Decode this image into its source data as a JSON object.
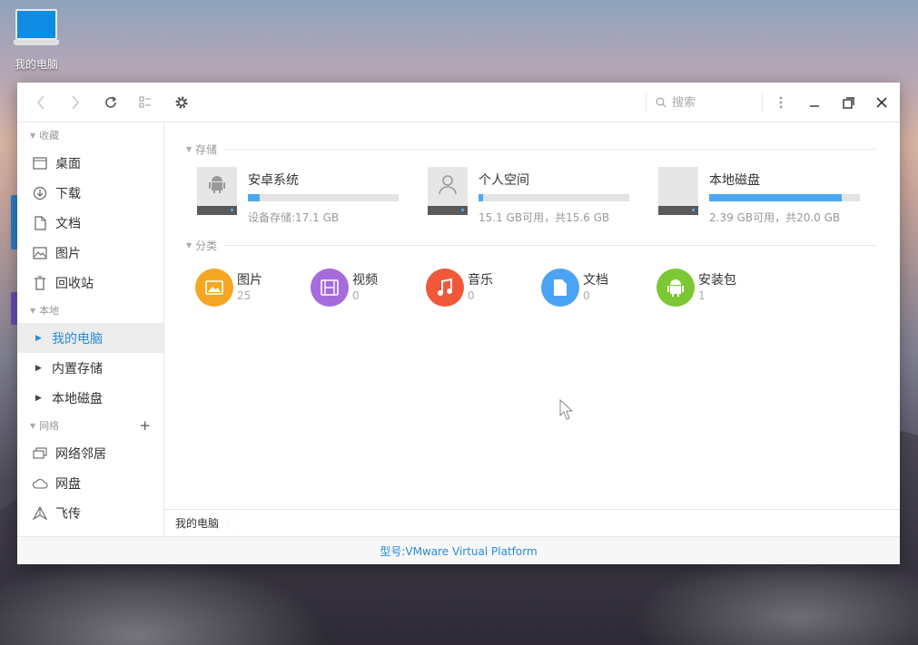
{
  "desktop": {
    "icon_label": "我的电脑"
  },
  "toolbar": {
    "search_placeholder": "搜索",
    "icons": [
      "back-icon",
      "forward-icon",
      "refresh-icon",
      "view-mode-icon",
      "settings-icon",
      "more-icon",
      "minimize-icon",
      "maximize-icon",
      "close-icon"
    ]
  },
  "sidebar": {
    "sections": [
      {
        "title": "收藏",
        "items": [
          {
            "label": "桌面",
            "icon": "desktop-icon"
          },
          {
            "label": "下载",
            "icon": "download-icon"
          },
          {
            "label": "文档",
            "icon": "document-icon"
          },
          {
            "label": "图片",
            "icon": "image-icon"
          },
          {
            "label": "回收站",
            "icon": "trash-icon"
          }
        ]
      },
      {
        "title": "本地",
        "items": [
          {
            "label": "我的电脑",
            "active": true
          },
          {
            "label": "内置存储"
          },
          {
            "label": "本地磁盘"
          }
        ]
      },
      {
        "title": "网络",
        "items": [
          {
            "label": "网络邻居",
            "icon": "network-neighbor-icon"
          },
          {
            "label": "网盘",
            "icon": "cloud-icon"
          },
          {
            "label": "飞传",
            "icon": "fly-transfer-icon"
          }
        ]
      }
    ]
  },
  "main": {
    "storage_title": "存储",
    "storage": [
      {
        "name": "安卓系统",
        "info": "设备存储:17.1 GB",
        "usage": 0.08,
        "icon": "android-icon"
      },
      {
        "name": "个人空间",
        "info": "15.1 GB可用，共15.6 GB",
        "usage": 0.03,
        "icon": "person-icon"
      },
      {
        "name": "本地磁盘",
        "info": "2.39 GB可用，共20.0 GB",
        "usage": 0.88,
        "icon": "disk-icon"
      }
    ],
    "category_title": "分类",
    "categories": [
      {
        "name": "图片",
        "count": "25",
        "color": "#f5a623",
        "icon": "image-icon"
      },
      {
        "name": "视频",
        "count": "0",
        "color": "#a66bdb",
        "icon": "video-icon"
      },
      {
        "name": "音乐",
        "count": "0",
        "color": "#f0583a",
        "icon": "music-icon"
      },
      {
        "name": "文档",
        "count": "0",
        "color": "#4aa3f5",
        "icon": "document-icon"
      },
      {
        "name": "安装包",
        "count": "1",
        "color": "#7cc734",
        "icon": "android-icon"
      }
    ]
  },
  "pathbar": {
    "crumb": "我的电脑"
  },
  "statusbar": {
    "text": "型号:VMware Virtual Platform"
  },
  "colors": {
    "accent": "#2a8bd8",
    "bar_fill": "#4ba8f0"
  }
}
